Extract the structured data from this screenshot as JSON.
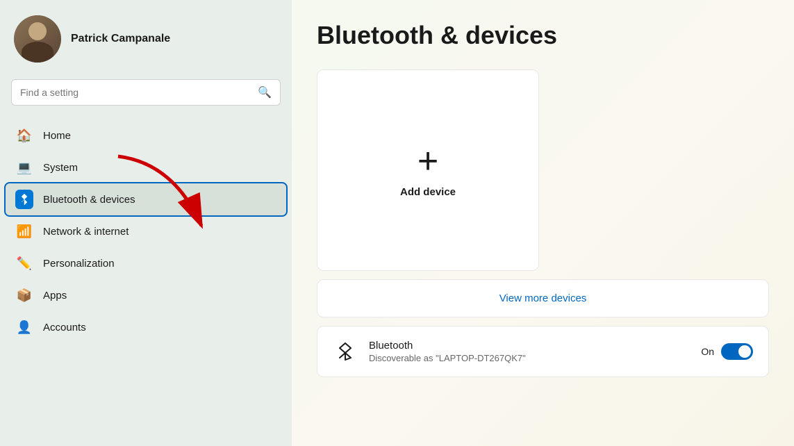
{
  "user": {
    "name": "Patrick Campanale"
  },
  "search": {
    "placeholder": "Find a setting"
  },
  "nav": {
    "items": [
      {
        "id": "home",
        "label": "Home",
        "icon": "🏠"
      },
      {
        "id": "system",
        "label": "System",
        "icon": "💻"
      },
      {
        "id": "bluetooth",
        "label": "Bluetooth & devices",
        "icon": "bt",
        "active": true
      },
      {
        "id": "network",
        "label": "Network & internet",
        "icon": "📶"
      },
      {
        "id": "personalization",
        "label": "Personalization",
        "icon": "✏️"
      },
      {
        "id": "apps",
        "label": "Apps",
        "icon": "📦"
      },
      {
        "id": "accounts",
        "label": "Accounts",
        "icon": "👤"
      }
    ]
  },
  "main": {
    "title": "Bluetooth & devices",
    "add_device": {
      "plus": "+",
      "label": "Add device"
    },
    "view_more": {
      "label": "View more devices"
    },
    "bluetooth": {
      "title": "Bluetooth",
      "subtitle": "Discoverable as \"LAPTOP-DT267QK7\"",
      "status": "On"
    }
  }
}
